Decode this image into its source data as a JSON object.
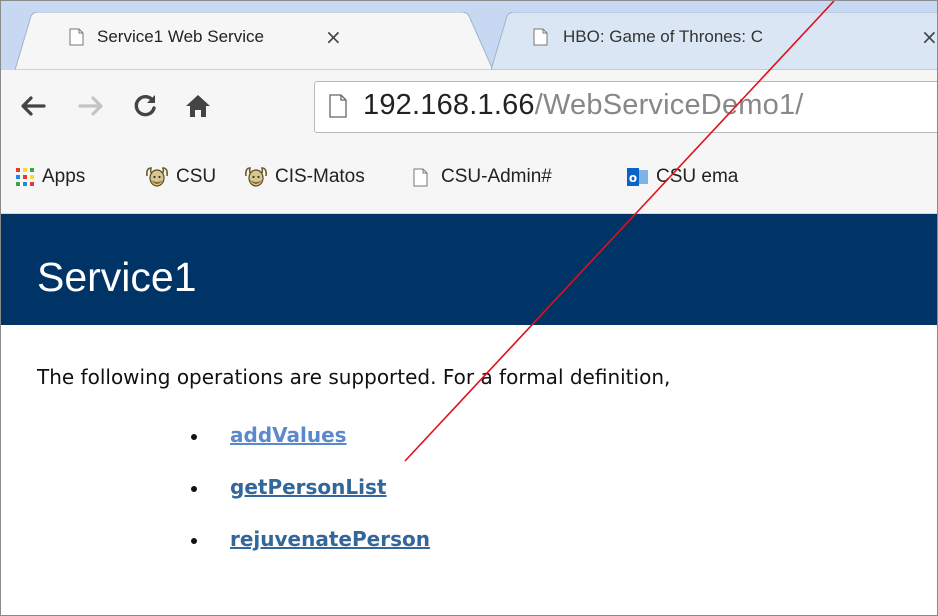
{
  "browser": {
    "tabs": [
      {
        "title": "Service1 Web Service",
        "close": "×",
        "active": true
      },
      {
        "title": "HBO: Game of Thrones: C",
        "close": "×",
        "active": false
      }
    ],
    "address": {
      "host": "192.168.1.66",
      "path": "/WebServiceDemo1/"
    },
    "nav": {
      "back": "back-arrow",
      "forward": "forward-arrow",
      "reload": "reload",
      "home": "home"
    },
    "bookmarks": [
      {
        "label": "Apps",
        "icon": "apps-grid-icon"
      },
      {
        "label": "CSU",
        "icon": "viking-icon"
      },
      {
        "label": "CIS-Matos",
        "icon": "viking-icon"
      },
      {
        "label": "CSU-Admin#",
        "icon": "page-icon"
      },
      {
        "label": "CSU ema",
        "icon": "outlook-icon"
      }
    ]
  },
  "page": {
    "title": "Service1",
    "intro": "The following operations are supported. For a formal definition,",
    "operations": [
      "addValues",
      "getPersonList",
      "rejuvenatePerson"
    ]
  },
  "colors": {
    "header_bg": "#003366",
    "link": "#336699",
    "visited_link": "#5b89c9",
    "annotation": "#e0101a"
  }
}
